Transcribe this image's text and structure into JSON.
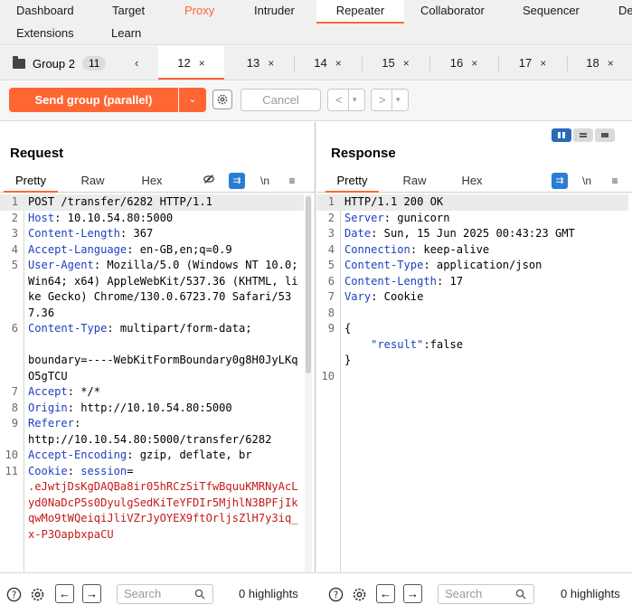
{
  "nav": {
    "row1": [
      "Dashboard",
      "Target",
      "Proxy",
      "Intruder",
      "Repeater",
      "Collaborator",
      "Sequencer",
      "De"
    ],
    "row2": [
      "Extensions",
      "Learn"
    ]
  },
  "subtabs": {
    "group_label": "Group 2",
    "group_count": "11",
    "tabs": [
      "12",
      "13",
      "14",
      "15",
      "16",
      "17",
      "18"
    ],
    "close_glyph": "×"
  },
  "toolbar": {
    "send_label": "Send group (parallel)",
    "cancel_label": "Cancel"
  },
  "request": {
    "title": "Request",
    "tabs": [
      "Pretty",
      "Raw",
      "Hex"
    ],
    "newline_label": "\\n",
    "lines": [
      {
        "n": "1",
        "parts": [
          {
            "t": "POST /transfer/6282 HTTP/1.1",
            "c": ""
          }
        ]
      },
      {
        "n": "2",
        "parts": [
          {
            "t": "Host",
            "c": "hk"
          },
          {
            "t": ": 10.10.54.80:5000",
            "c": ""
          }
        ]
      },
      {
        "n": "3",
        "parts": [
          {
            "t": "Content-Length",
            "c": "hk"
          },
          {
            "t": ": 367",
            "c": ""
          }
        ]
      },
      {
        "n": "4",
        "parts": [
          {
            "t": "Accept-Language",
            "c": "hk"
          },
          {
            "t": ": en-GB,en;q=0.9",
            "c": ""
          }
        ]
      },
      {
        "n": "5",
        "parts": [
          {
            "t": "User-Agent",
            "c": "hk"
          },
          {
            "t": ": Mozilla/5.0 (Windows NT 10.0; Win64; x64) AppleWebKit/537.36 (KHTML, like Gecko) Chrome/130.0.6723.70 Safari/537.36",
            "c": ""
          }
        ]
      },
      {
        "n": "6",
        "parts": [
          {
            "t": "Content-Type",
            "c": "hk"
          },
          {
            "t": ": multipart/form-data;\n\nboundary=----WebKitFormBoundary0g8H0JyLKqO5gTCU",
            "c": ""
          }
        ]
      },
      {
        "n": "7",
        "parts": [
          {
            "t": "Accept",
            "c": "hk"
          },
          {
            "t": ": */*",
            "c": ""
          }
        ]
      },
      {
        "n": "8",
        "parts": [
          {
            "t": "Origin",
            "c": "hk"
          },
          {
            "t": ": http://10.10.54.80:5000",
            "c": ""
          }
        ]
      },
      {
        "n": "9",
        "parts": [
          {
            "t": "Referer",
            "c": "hk"
          },
          {
            "t": ":\nhttp://10.10.54.80:5000/transfer/6282",
            "c": ""
          }
        ]
      },
      {
        "n": "10",
        "parts": [
          {
            "t": "Accept-Encoding",
            "c": "hk"
          },
          {
            "t": ": gzip, deflate, br",
            "c": ""
          }
        ]
      },
      {
        "n": "11",
        "parts": [
          {
            "t": "Cookie",
            "c": "hk"
          },
          {
            "t": ": ",
            "c": ""
          },
          {
            "t": "session",
            "c": "hk"
          },
          {
            "t": "=\n",
            "c": ""
          },
          {
            "t": ".eJwtjDsKgDAQBa8ir05hRCzSiTfwBquuKMRNyAcLyd0NaDcP5s0DyulgSedKiTeYFDIr5MjhlN3BPFjIkqwMo9tWQeiqiJliVZrJyOYEX9ftOrljsZlH7y3iq_x-P3OapbxpaCU",
            "c": "cv"
          }
        ]
      }
    ]
  },
  "response": {
    "title": "Response",
    "tabs": [
      "Pretty",
      "Raw",
      "Hex"
    ],
    "newline_label": "\\n",
    "lines": [
      {
        "n": "1",
        "parts": [
          {
            "t": "HTTP/1.1 200 OK",
            "c": ""
          }
        ]
      },
      {
        "n": "2",
        "parts": [
          {
            "t": "Server",
            "c": "hk"
          },
          {
            "t": ": gunicorn",
            "c": ""
          }
        ]
      },
      {
        "n": "3",
        "parts": [
          {
            "t": "Date",
            "c": "hk"
          },
          {
            "t": ": Sun, 15 Jun 2025 00:43:23 GMT",
            "c": ""
          }
        ]
      },
      {
        "n": "4",
        "parts": [
          {
            "t": "Connection",
            "c": "hk"
          },
          {
            "t": ": keep-alive",
            "c": ""
          }
        ]
      },
      {
        "n": "5",
        "parts": [
          {
            "t": "Content-Type",
            "c": "hk"
          },
          {
            "t": ": application/json",
            "c": ""
          }
        ]
      },
      {
        "n": "6",
        "parts": [
          {
            "t": "Content-Length",
            "c": "hk"
          },
          {
            "t": ": 17",
            "c": ""
          }
        ]
      },
      {
        "n": "7",
        "parts": [
          {
            "t": "Vary",
            "c": "hk"
          },
          {
            "t": ": Cookie",
            "c": ""
          }
        ]
      },
      {
        "n": "8",
        "parts": [
          {
            "t": "",
            "c": ""
          }
        ]
      },
      {
        "n": "9",
        "parts": [
          {
            "t": "{\n    ",
            "c": ""
          },
          {
            "t": "\"result\"",
            "c": "jk"
          },
          {
            "t": ":false\n}",
            "c": ""
          }
        ]
      },
      {
        "n": "10",
        "parts": [
          {
            "t": "",
            "c": ""
          }
        ]
      }
    ]
  },
  "bottom": {
    "search_placeholder": "Search",
    "highlights_left": "0 highlights",
    "highlights_right": "0 highlights"
  },
  "colors": {
    "accent": "#ff6633",
    "header_key": "#1f3fbf",
    "cookie_value": "#c41a16",
    "wrap_icon": "#2b7cd3"
  }
}
